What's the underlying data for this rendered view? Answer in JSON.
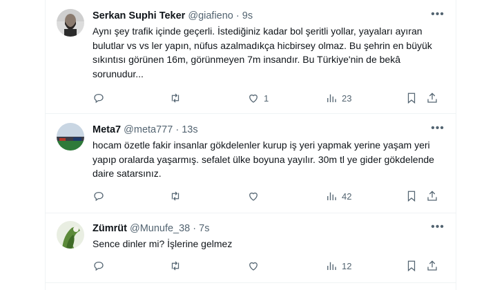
{
  "tweets": [
    {
      "name": "Serkan Suphi Teker",
      "handle": "@giafieno",
      "dot": "·",
      "time": "9s",
      "text": "Aynı şey trafik içinde geçerli. İstediğiniz kadar bol şeritli yollar, yayaları ayıran bulutlar vs vs ler yapın, nüfus azalmadıkça hicbirsey olmaz. Bu şehrin en büyük sıkıntısı görünen 16m, görünmeyen 7m insandır. Bu Türkiye'nin de bekâ sorunudur...",
      "replies": "",
      "retweets": "",
      "likes": "1",
      "views": "23"
    },
    {
      "name": "Meta7",
      "handle": "@meta777",
      "dot": "·",
      "time": "13s",
      "text": "hocam özetle fakir insanlar gökdelenler kurup iş yeri yapmak yerine yaşam yeri yapıp oralarda yaşarmış. sefalet ülke boyuna yayılır. 30m tl ye gider gökdelende daire satarsınız.",
      "replies": "",
      "retweets": "",
      "likes": "",
      "views": "42"
    },
    {
      "name": "Zümrüt",
      "handle": "@Munufe_38",
      "dot": "·",
      "time": "7s",
      "text": "Sence dinler mi? İşlerine gelmez",
      "replies": "",
      "retweets": "",
      "likes": "",
      "views": "12"
    }
  ],
  "icons": {
    "more": "more-horizontal-icon",
    "reply": "reply-icon",
    "retweet": "retweet-icon",
    "like": "heart-icon",
    "views": "views-chart-icon",
    "bookmark": "bookmark-icon",
    "share": "share-icon"
  },
  "more_glyph": "•••"
}
